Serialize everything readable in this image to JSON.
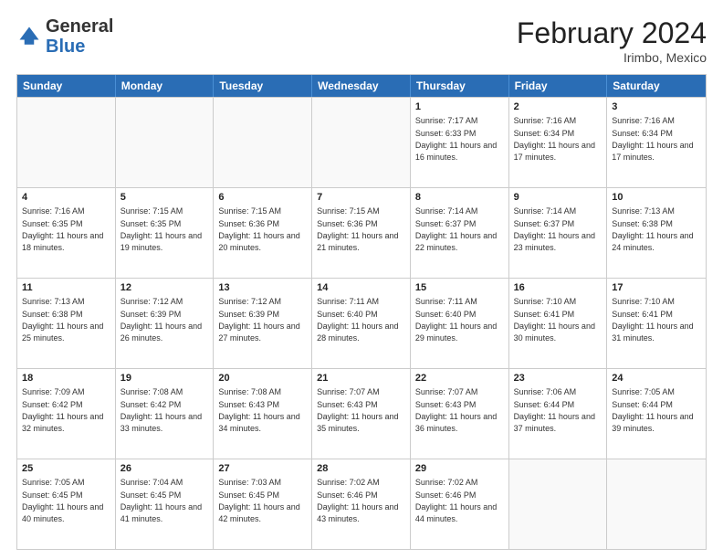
{
  "logo": {
    "general": "General",
    "blue": "Blue"
  },
  "title": {
    "month": "February 2024",
    "location": "Irimbo, Mexico"
  },
  "header_days": [
    "Sunday",
    "Monday",
    "Tuesday",
    "Wednesday",
    "Thursday",
    "Friday",
    "Saturday"
  ],
  "rows": [
    [
      {
        "day": "",
        "text": ""
      },
      {
        "day": "",
        "text": ""
      },
      {
        "day": "",
        "text": ""
      },
      {
        "day": "",
        "text": ""
      },
      {
        "day": "1",
        "text": "Sunrise: 7:17 AM\nSunset: 6:33 PM\nDaylight: 11 hours and 16 minutes."
      },
      {
        "day": "2",
        "text": "Sunrise: 7:16 AM\nSunset: 6:34 PM\nDaylight: 11 hours and 17 minutes."
      },
      {
        "day": "3",
        "text": "Sunrise: 7:16 AM\nSunset: 6:34 PM\nDaylight: 11 hours and 17 minutes."
      }
    ],
    [
      {
        "day": "4",
        "text": "Sunrise: 7:16 AM\nSunset: 6:35 PM\nDaylight: 11 hours and 18 minutes."
      },
      {
        "day": "5",
        "text": "Sunrise: 7:15 AM\nSunset: 6:35 PM\nDaylight: 11 hours and 19 minutes."
      },
      {
        "day": "6",
        "text": "Sunrise: 7:15 AM\nSunset: 6:36 PM\nDaylight: 11 hours and 20 minutes."
      },
      {
        "day": "7",
        "text": "Sunrise: 7:15 AM\nSunset: 6:36 PM\nDaylight: 11 hours and 21 minutes."
      },
      {
        "day": "8",
        "text": "Sunrise: 7:14 AM\nSunset: 6:37 PM\nDaylight: 11 hours and 22 minutes."
      },
      {
        "day": "9",
        "text": "Sunrise: 7:14 AM\nSunset: 6:37 PM\nDaylight: 11 hours and 23 minutes."
      },
      {
        "day": "10",
        "text": "Sunrise: 7:13 AM\nSunset: 6:38 PM\nDaylight: 11 hours and 24 minutes."
      }
    ],
    [
      {
        "day": "11",
        "text": "Sunrise: 7:13 AM\nSunset: 6:38 PM\nDaylight: 11 hours and 25 minutes."
      },
      {
        "day": "12",
        "text": "Sunrise: 7:12 AM\nSunset: 6:39 PM\nDaylight: 11 hours and 26 minutes."
      },
      {
        "day": "13",
        "text": "Sunrise: 7:12 AM\nSunset: 6:39 PM\nDaylight: 11 hours and 27 minutes."
      },
      {
        "day": "14",
        "text": "Sunrise: 7:11 AM\nSunset: 6:40 PM\nDaylight: 11 hours and 28 minutes."
      },
      {
        "day": "15",
        "text": "Sunrise: 7:11 AM\nSunset: 6:40 PM\nDaylight: 11 hours and 29 minutes."
      },
      {
        "day": "16",
        "text": "Sunrise: 7:10 AM\nSunset: 6:41 PM\nDaylight: 11 hours and 30 minutes."
      },
      {
        "day": "17",
        "text": "Sunrise: 7:10 AM\nSunset: 6:41 PM\nDaylight: 11 hours and 31 minutes."
      }
    ],
    [
      {
        "day": "18",
        "text": "Sunrise: 7:09 AM\nSunset: 6:42 PM\nDaylight: 11 hours and 32 minutes."
      },
      {
        "day": "19",
        "text": "Sunrise: 7:08 AM\nSunset: 6:42 PM\nDaylight: 11 hours and 33 minutes."
      },
      {
        "day": "20",
        "text": "Sunrise: 7:08 AM\nSunset: 6:43 PM\nDaylight: 11 hours and 34 minutes."
      },
      {
        "day": "21",
        "text": "Sunrise: 7:07 AM\nSunset: 6:43 PM\nDaylight: 11 hours and 35 minutes."
      },
      {
        "day": "22",
        "text": "Sunrise: 7:07 AM\nSunset: 6:43 PM\nDaylight: 11 hours and 36 minutes."
      },
      {
        "day": "23",
        "text": "Sunrise: 7:06 AM\nSunset: 6:44 PM\nDaylight: 11 hours and 37 minutes."
      },
      {
        "day": "24",
        "text": "Sunrise: 7:05 AM\nSunset: 6:44 PM\nDaylight: 11 hours and 39 minutes."
      }
    ],
    [
      {
        "day": "25",
        "text": "Sunrise: 7:05 AM\nSunset: 6:45 PM\nDaylight: 11 hours and 40 minutes."
      },
      {
        "day": "26",
        "text": "Sunrise: 7:04 AM\nSunset: 6:45 PM\nDaylight: 11 hours and 41 minutes."
      },
      {
        "day": "27",
        "text": "Sunrise: 7:03 AM\nSunset: 6:45 PM\nDaylight: 11 hours and 42 minutes."
      },
      {
        "day": "28",
        "text": "Sunrise: 7:02 AM\nSunset: 6:46 PM\nDaylight: 11 hours and 43 minutes."
      },
      {
        "day": "29",
        "text": "Sunrise: 7:02 AM\nSunset: 6:46 PM\nDaylight: 11 hours and 44 minutes."
      },
      {
        "day": "",
        "text": ""
      },
      {
        "day": "",
        "text": ""
      }
    ]
  ]
}
